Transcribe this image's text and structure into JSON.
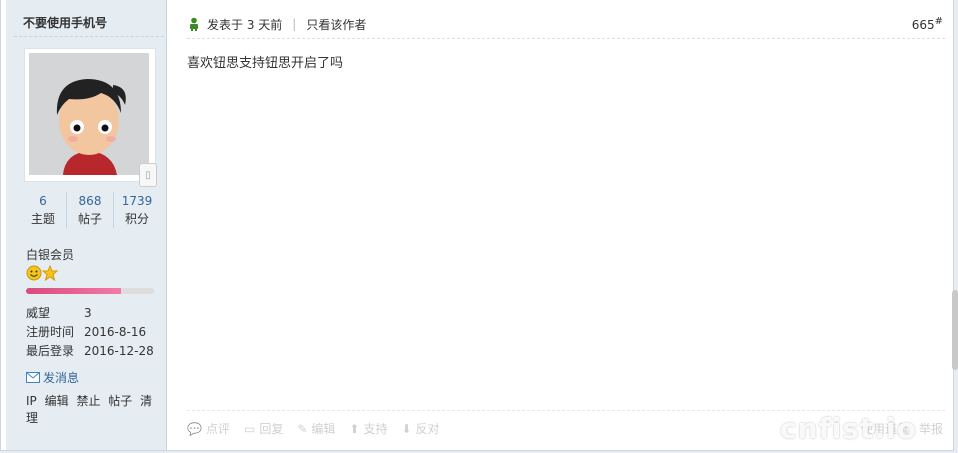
{
  "user": {
    "name": "不要使用手机号",
    "stats": [
      {
        "value": "6",
        "label": "主题"
      },
      {
        "value": "868",
        "label": "帖子"
      },
      {
        "value": "1739",
        "label": "积分"
      }
    ],
    "group": "白银会员",
    "level_progress": 0.74,
    "info": [
      {
        "k": "威望",
        "v": "3"
      },
      {
        "k": "注册时间",
        "v": "2016-8-16"
      },
      {
        "k": "最后登录",
        "v": "2016-12-28"
      }
    ],
    "pm_label": "发消息",
    "admin_links": [
      "IP",
      "编辑",
      "禁止",
      "帖子",
      "清理"
    ]
  },
  "post": {
    "posted": "发表于 3 天前",
    "only_author": "只看该作者",
    "floor": "665",
    "floor_mark": "#",
    "content": "喜欢钮思支持钮思开启了吗"
  },
  "actions": {
    "rate": "点评",
    "reply": "回复",
    "edit": "编辑",
    "support": "支持",
    "oppose": "反对",
    "right": [
      "使用道具",
      "举报"
    ]
  },
  "watermark": "cnfist.io"
}
